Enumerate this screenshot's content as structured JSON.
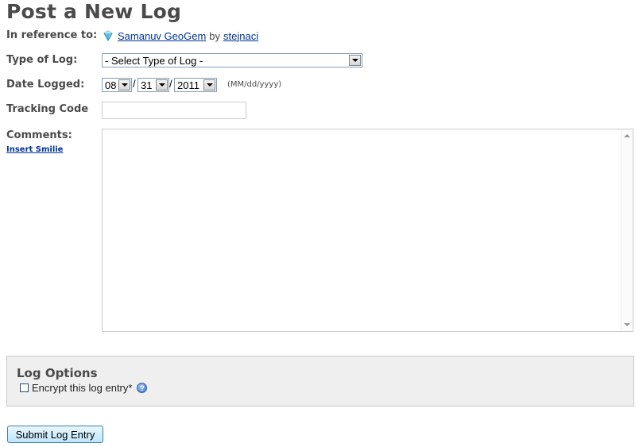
{
  "page": {
    "title": "Post a New Log"
  },
  "form": {
    "reference": {
      "label": "In reference to:",
      "cache_name": "Samanuv GeoGem",
      "by": "by",
      "owner": "stejnaci",
      "icon": "geogem-icon"
    },
    "log_type": {
      "label": "Type of Log:",
      "selected": "- Select Type of Log -"
    },
    "date_logged": {
      "label": "Date Logged:",
      "month": "08",
      "day": "31",
      "year": "2011",
      "separator": "/",
      "format_hint": "(MM/dd/yyyy)"
    },
    "tracking_code": {
      "label": "Tracking Code",
      "value": ""
    },
    "comments": {
      "label": "Comments:",
      "insert_smilie": "Insert Smilie",
      "value": ""
    }
  },
  "log_options": {
    "title": "Log Options",
    "encrypt_label": "Encrypt this log entry*",
    "encrypt_checked": false,
    "help_icon": "help-icon"
  },
  "submit": {
    "label": "Submit Log Entry"
  },
  "colors": {
    "link": "#003399",
    "text": "#4a4a4a",
    "options_bg": "#efefef"
  }
}
